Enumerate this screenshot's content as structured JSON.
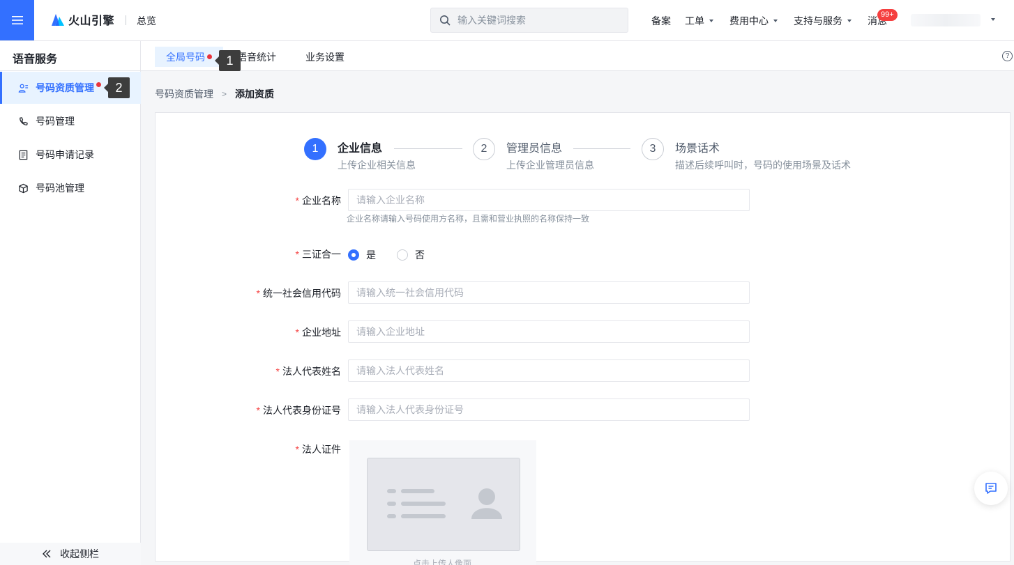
{
  "header": {
    "brand": "火山引擎",
    "overview": "总览",
    "search_placeholder": "输入关键词搜索",
    "nav": [
      {
        "label": "备案",
        "dropdown": false
      },
      {
        "label": "工单",
        "dropdown": true
      },
      {
        "label": "费用中心",
        "dropdown": true
      },
      {
        "label": "支持与服务",
        "dropdown": true
      },
      {
        "label": "消息",
        "dropdown": false
      }
    ],
    "message_badge": "99+"
  },
  "sidebar": {
    "service_title": "语音服务",
    "items": [
      {
        "label": "号码资质管理",
        "icon": "user-card-icon",
        "active": true,
        "dot": true
      },
      {
        "label": "号码管理",
        "icon": "phone-icon",
        "active": false
      },
      {
        "label": "号码申请记录",
        "icon": "document-icon",
        "active": false
      },
      {
        "label": "号码池管理",
        "icon": "cube-icon",
        "active": false
      }
    ],
    "collapse_label": "收起侧栏"
  },
  "tabs": [
    {
      "label": "全局号码",
      "active": true,
      "dot": true
    },
    {
      "label": "语音统计",
      "active": false
    },
    {
      "label": "业务设置",
      "active": false
    }
  ],
  "tooltips": {
    "one": "1",
    "two": "2"
  },
  "breadcrumb": {
    "parent": "号码资质管理",
    "current": "添加资质"
  },
  "steps": [
    {
      "number": "1",
      "title": "企业信息",
      "desc": "上传企业相关信息",
      "active": true
    },
    {
      "number": "2",
      "title": "管理员信息",
      "desc": "上传企业管理员信息",
      "active": false
    },
    {
      "number": "3",
      "title": "场景话术",
      "desc": "描述后续呼叫时，号码的使用场景及话术",
      "active": false
    }
  ],
  "form": {
    "company_name": {
      "label": "企业名称",
      "placeholder": "请输入企业名称",
      "hint": "企业名称请输入号码使用方名称，且需和营业执照的名称保持一致"
    },
    "three_in_one": {
      "label": "三证合一",
      "options": [
        "是",
        "否"
      ],
      "selected": "是"
    },
    "credit_code": {
      "label": "统一社会信用代码",
      "placeholder": "请输入统一社会信用代码"
    },
    "address": {
      "label": "企业地址",
      "placeholder": "请输入企业地址"
    },
    "legal_name": {
      "label": "法人代表姓名",
      "placeholder": "请输入法人代表姓名"
    },
    "legal_id": {
      "label": "法人代表身份证号",
      "placeholder": "请输入法人代表身份证号"
    },
    "legal_cert": {
      "label": "法人证件",
      "upload_text": "点击上传人像面"
    }
  },
  "colors": {
    "primary": "#3370ff",
    "danger": "#f53f3f",
    "dot": "#e8343d"
  }
}
